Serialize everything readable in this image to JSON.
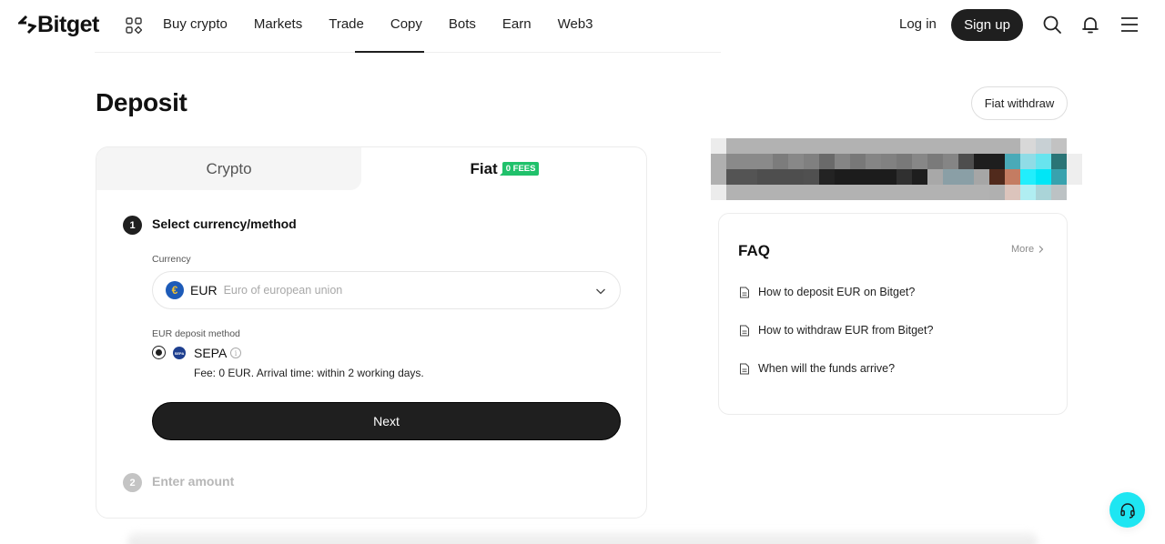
{
  "header": {
    "brand": "Bitget",
    "nav": [
      "Buy crypto",
      "Markets",
      "Trade",
      "Copy",
      "Bots",
      "Earn",
      "Web3"
    ],
    "login_label": "Log in",
    "signup_label": "Sign up",
    "icons": [
      "apps-grid-icon",
      "search-icon",
      "bell-icon",
      "menu-icon"
    ]
  },
  "page": {
    "title": "Deposit",
    "fiat_withdraw_label": "Fiat withdraw"
  },
  "deposit_card": {
    "tabs": [
      {
        "label": "Crypto",
        "active": false
      },
      {
        "label": "Fiat",
        "active": true,
        "badge": "0 FEES"
      }
    ],
    "step1": {
      "number": "1",
      "title": "Select currency/method",
      "currency_label": "Currency",
      "currency": {
        "code": "EUR",
        "name": "Euro of european union",
        "symbol": "€"
      },
      "method_label": "EUR deposit method",
      "method": {
        "name": "SEPA",
        "icon_text": "SEPA",
        "selected": true,
        "fee_text": "Fee: 0 EUR. Arrival time: within 2 working days."
      },
      "next_label": "Next"
    },
    "step2": {
      "number": "2",
      "title": "Enter amount"
    }
  },
  "faq": {
    "title": "FAQ",
    "more_label": "More",
    "items": [
      "How to deposit EUR on Bitget?",
      "How to withdraw EUR from Bitget?",
      "When will the funds arrive?"
    ]
  },
  "banner": {
    "description": "pixelated promotional banner",
    "rows": [
      [
        "#ececec",
        "#b2b2b2",
        "#b2b2b2",
        "#b2b2b2",
        "#b2b2b2",
        "#b2b2b2",
        "#b2b2b2",
        "#b2b2b2",
        "#b2b2b2",
        "#b2b2b2",
        "#b2b2b2",
        "#b2b2b2",
        "#b2b2b2",
        "#b2b2b2",
        "#b2b2b2",
        "#b2b2b2",
        "#b2b2b2",
        "#b2b2b2",
        "#b2b2b2",
        "#b2b2b2",
        "#d8d8d8",
        "#c8d0d4",
        "#c2c2c2",
        "#ffffff"
      ],
      [
        "#b0b0b0",
        "#8a8a8a",
        "#8a8a8a",
        "#8a8a8a",
        "#7c7c7c",
        "#888888",
        "#808080",
        "#6a6a6a",
        "#858585",
        "#787878",
        "#858585",
        "#818181",
        "#797979",
        "#878787",
        "#7a7a7a",
        "#858585",
        "#4e4e4e",
        "#1e1e1e",
        "#1e1e1e",
        "#4aaab8",
        "#90dce6",
        "#68e4ee",
        "#2a7476",
        "#eeeeee"
      ],
      [
        "#b0b0b0",
        "#545454",
        "#545454",
        "#4e4e4e",
        "#4e4e4e",
        "#4e4e4e",
        "#505050",
        "#232323",
        "#1c1c1c",
        "#1c1c1c",
        "#1c1c1c",
        "#1c1c1c",
        "#303030",
        "#1e1e1e",
        "#a8a8a8",
        "#8a9fa6",
        "#8a9fa6",
        "#a6a6a6",
        "#512a1c",
        "#c47c62",
        "#22eefc",
        "#00e6f6",
        "#38a2ae",
        "#eeeeee"
      ],
      [
        "#ececec",
        "#b2b2b2",
        "#b2b2b2",
        "#b2b2b2",
        "#b2b2b2",
        "#b2b2b2",
        "#b2b2b2",
        "#b2b2b2",
        "#b2b2b2",
        "#b2b2b2",
        "#b2b2b2",
        "#b2b2b2",
        "#b2b2b2",
        "#b2b2b2",
        "#b2b2b2",
        "#b2b2b2",
        "#b2b2b2",
        "#b2b2b2",
        "#b0b0b0",
        "#dcc4bc",
        "#b0eef2",
        "#aad4d8",
        "#bcc2c4",
        "#ffffff"
      ]
    ]
  },
  "support_icon": "headset-icon",
  "colors": {
    "primary_button": "#1f1f1f",
    "fees_badge": "#20c16b",
    "support_button": "#1ee6f2",
    "eur_coin": "#1d5bb8",
    "sepa_icon": "#1e3f8f"
  }
}
